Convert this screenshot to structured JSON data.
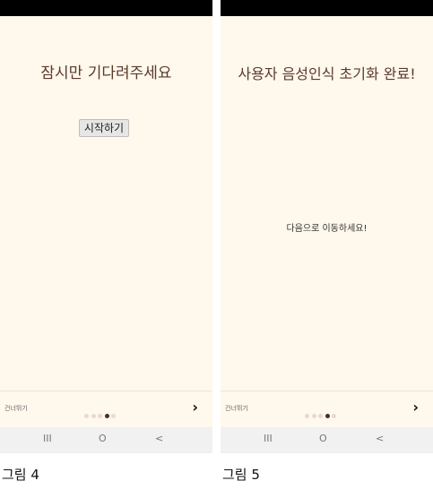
{
  "screens": [
    {
      "title": "잠시만 기다려주세요",
      "button_label": "시작하기",
      "skip_label": "건너뛰기",
      "next_label": "›",
      "dots": [
        false,
        false,
        false,
        true,
        false
      ],
      "nav": {
        "recent": "III",
        "home": "O",
        "back": "<"
      },
      "caption": "그림 4"
    },
    {
      "title": "사용자 음성인식 초기화 완료!",
      "message": "다음으로 이동하세요!",
      "skip_label": "건너뛰기",
      "next_label": "›",
      "dots": [
        false,
        false,
        false,
        true,
        false
      ],
      "nav": {
        "recent": "III",
        "home": "O",
        "back": "<"
      },
      "caption": "그림 5"
    }
  ],
  "colors": {
    "screen_bg": "#fff8ec",
    "title": "#5a3a2c",
    "active_dot": "#4a2a35",
    "inactive_dot": "#ead9d1"
  }
}
